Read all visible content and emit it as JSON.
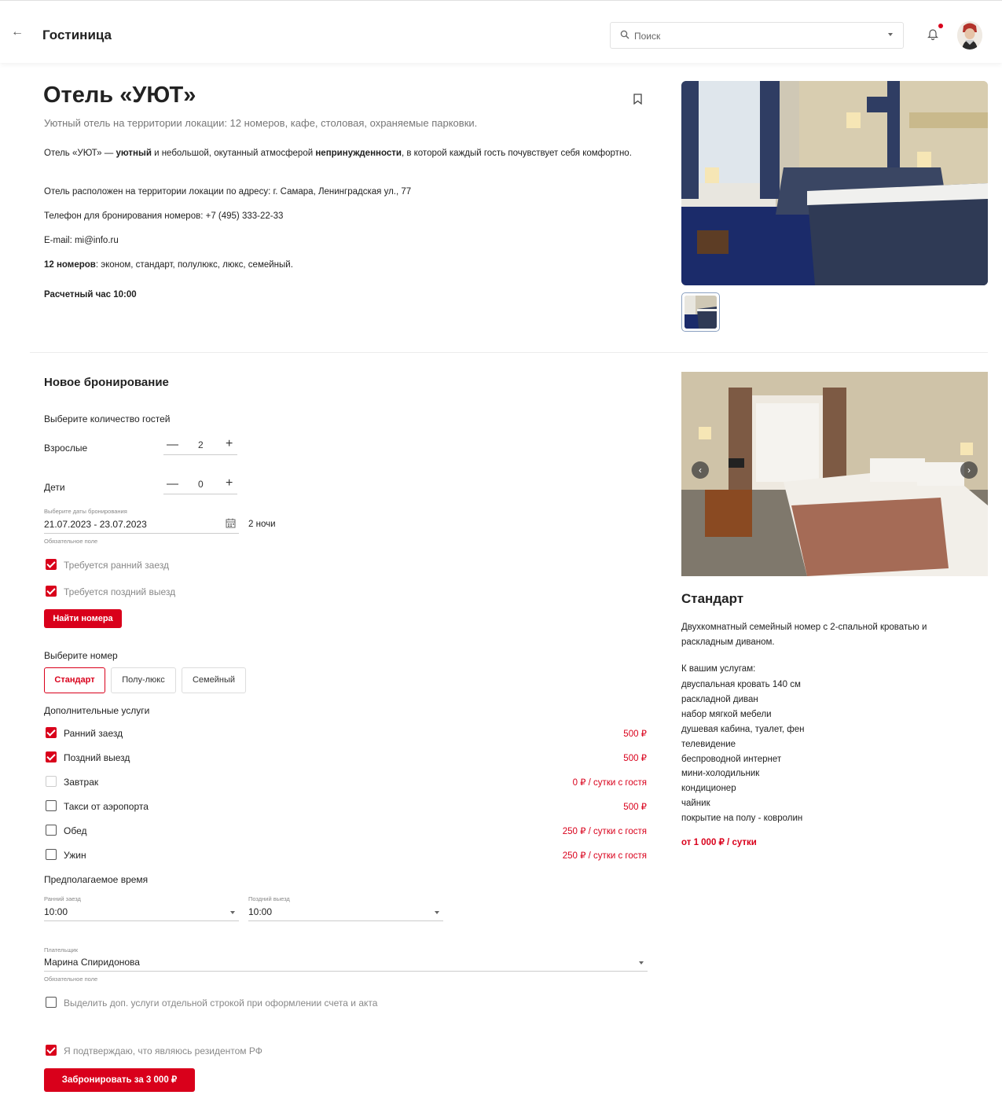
{
  "header": {
    "back_icon": "arrow-left-icon",
    "title": "Гостиница",
    "search_placeholder": "Поиск",
    "notification_icon": "bell-icon",
    "accent_color": "#d9001b"
  },
  "hotel": {
    "name": "Отель «УЮТ»",
    "subtitle": "Уютный отель на территории локации: 12 номеров, кафе, столовая, охраняемые парковки.",
    "desc_part1": "Отель «УЮТ» — ",
    "desc_bold1": "уютный",
    "desc_part2": " и небольшой, окутанный атмосферой ",
    "desc_bold2": "непринужденности",
    "desc_part3": ", в которой каждый гость почувствует себя комфортно.",
    "address": "Отель расположен на территории локации по адресу: г. Самара, Ленинградская ул., 77",
    "phone": "Телефон для бронирования номеров: +7 (495) 333-22-33",
    "email": "E-mail: mi@info.ru",
    "rooms_bold": "12 номеров",
    "rooms_list": ": эконом, стандарт, полулюкс, люкс, семейный.",
    "checkout": "Расчетный час 10:00"
  },
  "booking": {
    "title": "Новое бронирование",
    "guests_title": "Выберите количество гостей",
    "adults_label": "Взрослые",
    "adults_value": "2",
    "children_label": "Дети",
    "children_value": "0",
    "dates_label": "Выберите даты бронирования",
    "dates_value": "21.07.2023 - 23.07.2023",
    "dates_hint": "Обязательное поле",
    "nights": "2 ночи",
    "early_checkin": "Требуется ранний заезд",
    "late_checkout": "Требуется поздний выезд",
    "find_button": "Найти номера",
    "room_title": "Выберите номер",
    "room_tabs": [
      "Стандарт",
      "Полу-люкс",
      "Семейный"
    ],
    "services_title": "Дополнительные услуги",
    "services": [
      {
        "label": "Ранний заезд",
        "price": "500 ₽",
        "checked": true
      },
      {
        "label": "Поздний выезд",
        "price": "500 ₽",
        "checked": true
      },
      {
        "label": "Завтрак",
        "price": "0 ₽ / сутки с гостя",
        "checked": false
      },
      {
        "label": "Такси от аэропорта",
        "price": "500 ₽",
        "checked": false
      },
      {
        "label": "Обед",
        "price": "250 ₽ / сутки с гостя",
        "checked": false
      },
      {
        "label": "Ужин",
        "price": "250 ₽ / сутки с гостя",
        "checked": false
      }
    ],
    "time_title": "Предполагаемое время",
    "early_time_label": "Ранний заезд",
    "early_time_value": "10:00",
    "late_time_label": "Поздний выезд",
    "late_time_value": "10:00",
    "payer_label": "Плательщик",
    "payer_value": "Марина Спиридонова",
    "payer_hint": "Обязательное поле",
    "separate_line": "Выделить доп. услуги отдельной строкой при оформлении счета и акта",
    "resident_confirm": "Я подтверждаю, что являюсь резидентом РФ",
    "book_button": "Забронировать за 3 000 ₽"
  },
  "room_card": {
    "title": "Стандарт",
    "description": "Двухкомнатный семейный номер с 2-спальной кроватью и раскладным диваном.",
    "amenities_title": "К вашим услугам:",
    "amenities": [
      "двуспальная кровать 140 см",
      "раскладной диван",
      "набор мягкой мебели",
      "душевая кабина, туалет, фен",
      "телевидение",
      "беспроводной интернет",
      "мини-холодильник",
      "кондиционер",
      "чайник",
      "покрытие на полу - ковролин"
    ],
    "price": "от 1 000 ₽ / сутки",
    "prev_icon": "chevron-left-icon",
    "next_icon": "chevron-right-icon"
  }
}
